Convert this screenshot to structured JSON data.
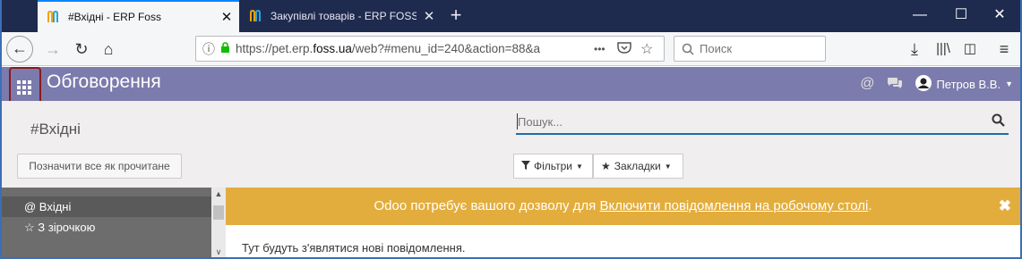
{
  "browser": {
    "tabs": [
      {
        "label": "#Вхідні - ERP Foss",
        "active": true
      },
      {
        "label": "Закупівлі товарів - ERP FOSS",
        "active": false
      }
    ],
    "new_tab_symbol": "+",
    "window_controls": {
      "minimize": "—",
      "maximize": "☐",
      "close": "✕"
    },
    "address": {
      "info_icon": "info-icon",
      "lock_icon": "lock-icon",
      "url_prefix": "https://pet.erp.",
      "url_domain": "foss.ua",
      "url_rest": "/web?#menu_id=240&action=88&a",
      "more": "•••"
    },
    "search_placeholder": "Поиск"
  },
  "app": {
    "title": "Обговорення",
    "user": "Петров В.В.",
    "at_symbol": "@",
    "colors": {
      "topbar": "#7c7bad",
      "accent": "#1c6fa8",
      "notification": "#e3ad3d"
    }
  },
  "control_panel": {
    "breadcrumb": "#Вхідні",
    "search_placeholder": "Пошук...",
    "mark_all_read": "Позначити все як прочитане",
    "filters": "Фільтри",
    "favorites": "Закладки"
  },
  "sidebar": {
    "items": [
      {
        "label": "@ Вхідні",
        "active": true
      },
      {
        "label": "☆ З зірочкою",
        "active": false
      }
    ]
  },
  "notification": {
    "text": "Odoo потребує вашого дозволу для ",
    "link": "Включити повідомлення на робочому столі",
    "suffix": ".",
    "close": "✖"
  },
  "messages": {
    "empty": "Тут будуть з'являтися нові повідомлення."
  }
}
